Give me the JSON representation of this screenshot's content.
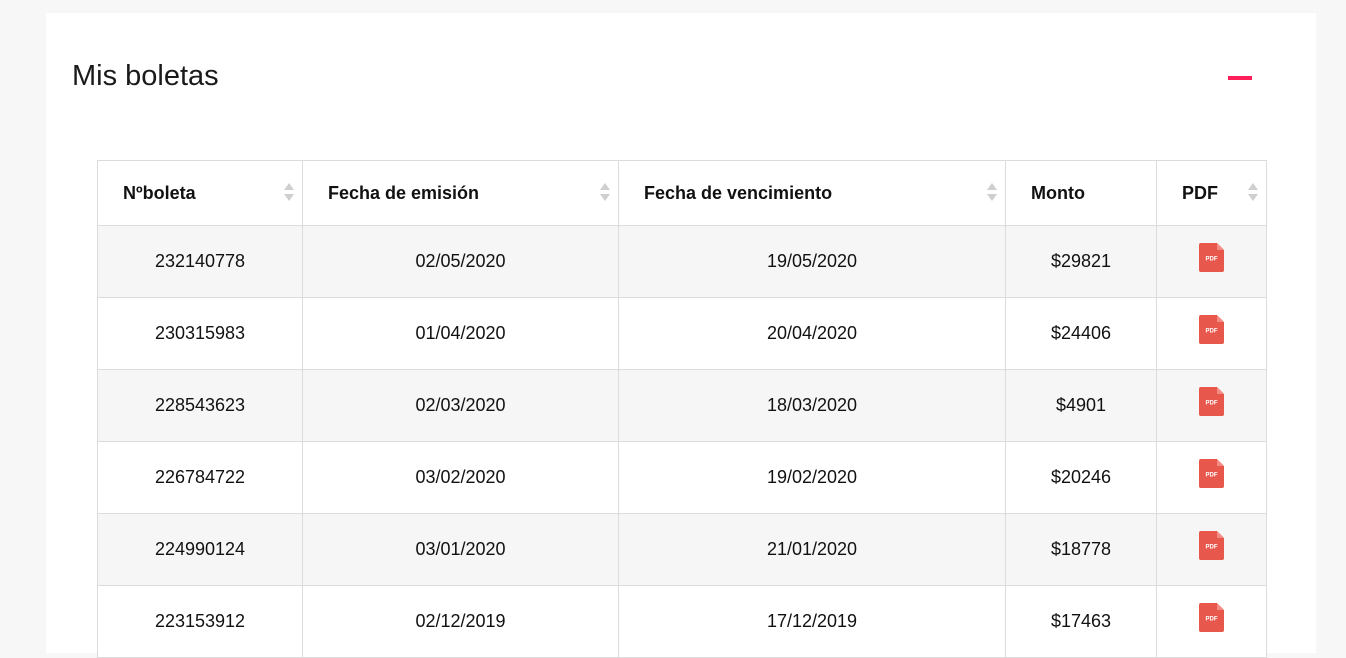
{
  "section": {
    "title": "Mis boletas"
  },
  "colors": {
    "accent": "#ff1e5a",
    "pdf_icon": "#e8574c",
    "row_alt": "#f6f6f6"
  },
  "table": {
    "headers": [
      "Nºboleta",
      "Fecha de emisión",
      "Fecha de vencimiento",
      "Monto",
      "PDF"
    ],
    "pdf_icon_label": "PDF",
    "rows": [
      {
        "numero": "232140778",
        "emision": "02/05/2020",
        "vencimiento": "19/05/2020",
        "monto": "$29821"
      },
      {
        "numero": "230315983",
        "emision": "01/04/2020",
        "vencimiento": "20/04/2020",
        "monto": "$24406"
      },
      {
        "numero": "228543623",
        "emision": "02/03/2020",
        "vencimiento": "18/03/2020",
        "monto": "$4901"
      },
      {
        "numero": "226784722",
        "emision": "03/02/2020",
        "vencimiento": "19/02/2020",
        "monto": "$20246"
      },
      {
        "numero": "224990124",
        "emision": "03/01/2020",
        "vencimiento": "21/01/2020",
        "monto": "$18778"
      },
      {
        "numero": "223153912",
        "emision": "02/12/2019",
        "vencimiento": "17/12/2019",
        "monto": "$17463"
      }
    ]
  }
}
